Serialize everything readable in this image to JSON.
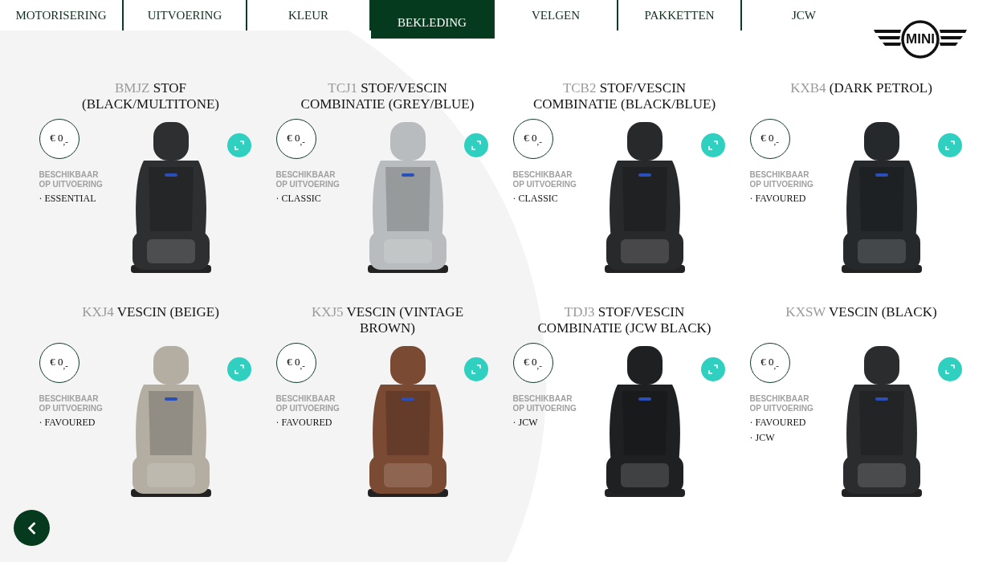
{
  "tabs": [
    {
      "label": "MOTORISERING",
      "selected": false
    },
    {
      "label": "UITVOERING",
      "selected": false
    },
    {
      "label": "KLEUR",
      "selected": false
    },
    {
      "label": "BEKLEDING",
      "selected": true
    },
    {
      "label": "VELGEN",
      "selected": false
    },
    {
      "label": "PAKKETTEN",
      "selected": false
    },
    {
      "label": "JCW",
      "selected": false
    }
  ],
  "logo": {
    "text": "MINI"
  },
  "seats": [
    {
      "code": "BMJZ",
      "name": "STOF (BLACK/MULTITONE)",
      "price": "€ 0$_{,-}$",
      "availability_label": "BESCHIKBAAR OP UITVOERING",
      "trims": [
        "· ESSENTIAL"
      ],
      "color": "#2e2f31"
    },
    {
      "code": "TCJ1",
      "name": "STOF/VESCIN COMBINATIE (GREY/BLUE)",
      "price": "€ 0$_{,-}$",
      "availability_label": "BESCHIKBAAR OP UITVOERING",
      "trims": [
        "· CLASSIC"
      ],
      "color": "#b9bcbe"
    },
    {
      "code": "TCB2",
      "name": "STOF/VESCIN COMBINATIE (BLACK/BLUE)",
      "price": "€ 0$_{,-}$",
      "availability_label": "BESCHIKBAAR OP UITVOERING",
      "trims": [
        "· CLASSIC"
      ],
      "color": "#28292b"
    },
    {
      "code": "KXB4",
      "name": "(DARK PETROL)",
      "price": "€ 0$_{,-}$",
      "availability_label": "BESCHIKBAAR OP UITVOERING",
      "trims": [
        "· FAVOURED"
      ],
      "color": "#25292c"
    },
    {
      "code": "KXJ4",
      "name": "VESCIN (BEIGE)",
      "price": "€ 0$_{,-}$",
      "availability_label": "BESCHIKBAAR OP UITVOERING",
      "trims": [
        "· FAVOURED"
      ],
      "color": "#b3ada2"
    },
    {
      "code": "KXJ5",
      "name": "VESCIN (VINTAGE BROWN)",
      "price": "€ 0$_{,-}$",
      "availability_label": "BESCHIKBAAR OP UITVOERING",
      "trims": [
        "· FAVOURED"
      ],
      "color": "#7a4a33"
    },
    {
      "code": "TDJ3",
      "name": "STOF/VESCIN COMBINATIE (JCW BLACK)",
      "price": "€ 0$_{,-}$",
      "availability_label": "BESCHIKBAAR OP UITVOERING",
      "trims": [
        "· JCW"
      ],
      "color": "#1f2022"
    },
    {
      "code": "KXSW",
      "name": "VESCIN (BLACK)",
      "price": "€ 0$_{,-}$",
      "availability_label": "BESCHIKBAAR OP UITVOERING",
      "trims": [
        "· FAVOURED",
        "· JCW"
      ],
      "color": "#2a2c2e"
    }
  ]
}
